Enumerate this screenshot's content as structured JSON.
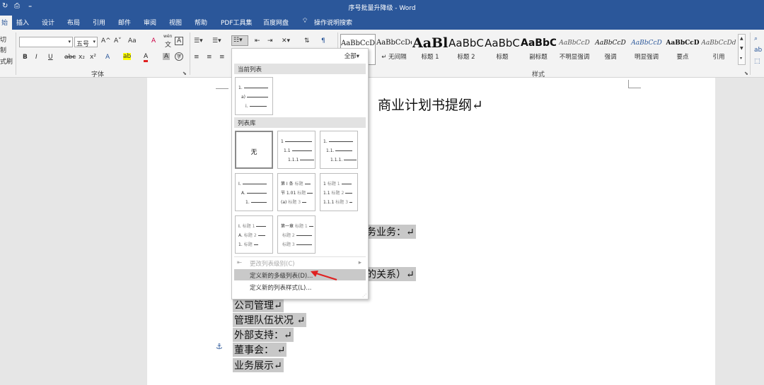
{
  "window": {
    "title": "序号批量升降级 - Word"
  },
  "tabs": [
    {
      "label": "始"
    },
    {
      "label": "插入"
    },
    {
      "label": "设计"
    },
    {
      "label": "布局"
    },
    {
      "label": "引用"
    },
    {
      "label": "邮件"
    },
    {
      "label": "审阅"
    },
    {
      "label": "视图"
    },
    {
      "label": "帮助"
    },
    {
      "label": "PDF工具集"
    },
    {
      "label": "百度网盘"
    },
    {
      "label": "操作说明搜索"
    }
  ],
  "ribbon": {
    "clipboard_partial": [
      "切",
      "制",
      "式刷"
    ],
    "font": {
      "size": "五号",
      "grow": "A^",
      "shrink": "A˅",
      "case": "Aa",
      "clear": "A",
      "phonetic_top": "wén",
      "phonetic_bottom": "文",
      "border_char": "A",
      "bold": "B",
      "italic": "I",
      "underline": "U",
      "strike": "abc",
      "sub": "x₂",
      "sup": "x²",
      "effects": "A",
      "highlight": "ab",
      "color": "A",
      "shade": "A",
      "enclose": "字",
      "group_label": "字体"
    },
    "styles": {
      "group_label": "样式",
      "items": [
        {
          "preview": "AaBbCcDd",
          "name": "正文"
        },
        {
          "preview": "AaBbCcDd",
          "name": "↵ 无间隔"
        },
        {
          "preview": "AaBl",
          "name": "标题 1"
        },
        {
          "preview": "AaBbC",
          "name": "标题 2"
        },
        {
          "preview": "AaBbC",
          "name": "标题"
        },
        {
          "preview": "AaBbC",
          "name": "副标题"
        },
        {
          "preview": "AaBbCcD",
          "name": "不明显强调"
        },
        {
          "preview": "AaBbCcD",
          "name": "强调"
        },
        {
          "preview": "AaBbCcD",
          "name": "明显强调"
        },
        {
          "preview": "AaBbCcD",
          "name": "要点"
        },
        {
          "preview": "AaBbCcDd",
          "name": "引用"
        }
      ]
    }
  },
  "document": {
    "title": "商业计划书提纲↵",
    "partial_lines": [
      "务业务：↵",
      "的关系）↵"
    ],
    "paragraphs": [
      "公司管理↵",
      "管理队伍状况 ↵",
      "外部支持：↵",
      "董事会： ↵",
      "业务展示↵"
    ]
  },
  "multilevel_menu": {
    "filter": "全部▾",
    "current_list_header": "当前列表",
    "library_header": "列表库",
    "none_label": "无",
    "current_list": [
      {
        "num": "1.",
        "w": 34
      },
      {
        "num": "a)",
        "w": 30
      },
      {
        "num": "i.",
        "w": 24
      }
    ],
    "library": [
      [
        {
          "num": "1",
          "w": 38
        },
        {
          "num": "1.1",
          "w": 28
        },
        {
          "num": "1.1.1",
          "w": 20
        }
      ],
      [
        {
          "num": "1.",
          "w": 34
        },
        {
          "num": "1.1.",
          "w": 24
        },
        {
          "num": "1.1.1.",
          "w": 18
        }
      ],
      [
        {
          "num": "I.",
          "w": 34
        },
        {
          "num": "A.",
          "w": 28
        },
        {
          "num": "1.",
          "w": 22
        }
      ],
      [
        {
          "num": "第 I 条",
          "tag": "标题",
          "w": 8
        },
        {
          "num": "节 1.01",
          "tag": "标题",
          "w": 8
        },
        {
          "num": "(a)",
          "tag": "标题 3",
          "w": 6
        }
      ],
      [
        {
          "num": "1",
          "tag": "标题 1",
          "w": 14
        },
        {
          "num": "1.1",
          "tag": "标题 2",
          "w": 10
        },
        {
          "num": "1.1.1",
          "tag": "标题 3",
          "w": 4
        }
      ],
      [
        {
          "num": "I.",
          "tag": "标题 1",
          "w": 14
        },
        {
          "num": "A.",
          "tag": "标题 2",
          "w": 10
        },
        {
          "num": "1.",
          "tag": "标题",
          "w": 6
        }
      ],
      [
        {
          "num": "第一章",
          "tag": "标题 1",
          "w": 6
        },
        {
          "num": "",
          "tag": "标题 2",
          "w": 22
        },
        {
          "num": "",
          "tag": "标题 3",
          "w": 22
        }
      ]
    ],
    "change_level": "更改列表级别(C)",
    "define_new_multilevel": "定义新的多级列表(D)...",
    "define_new_style": "定义新的列表样式(L)..."
  },
  "colors": {
    "accent": "#2b579a",
    "red_arrow": "#e02020"
  }
}
